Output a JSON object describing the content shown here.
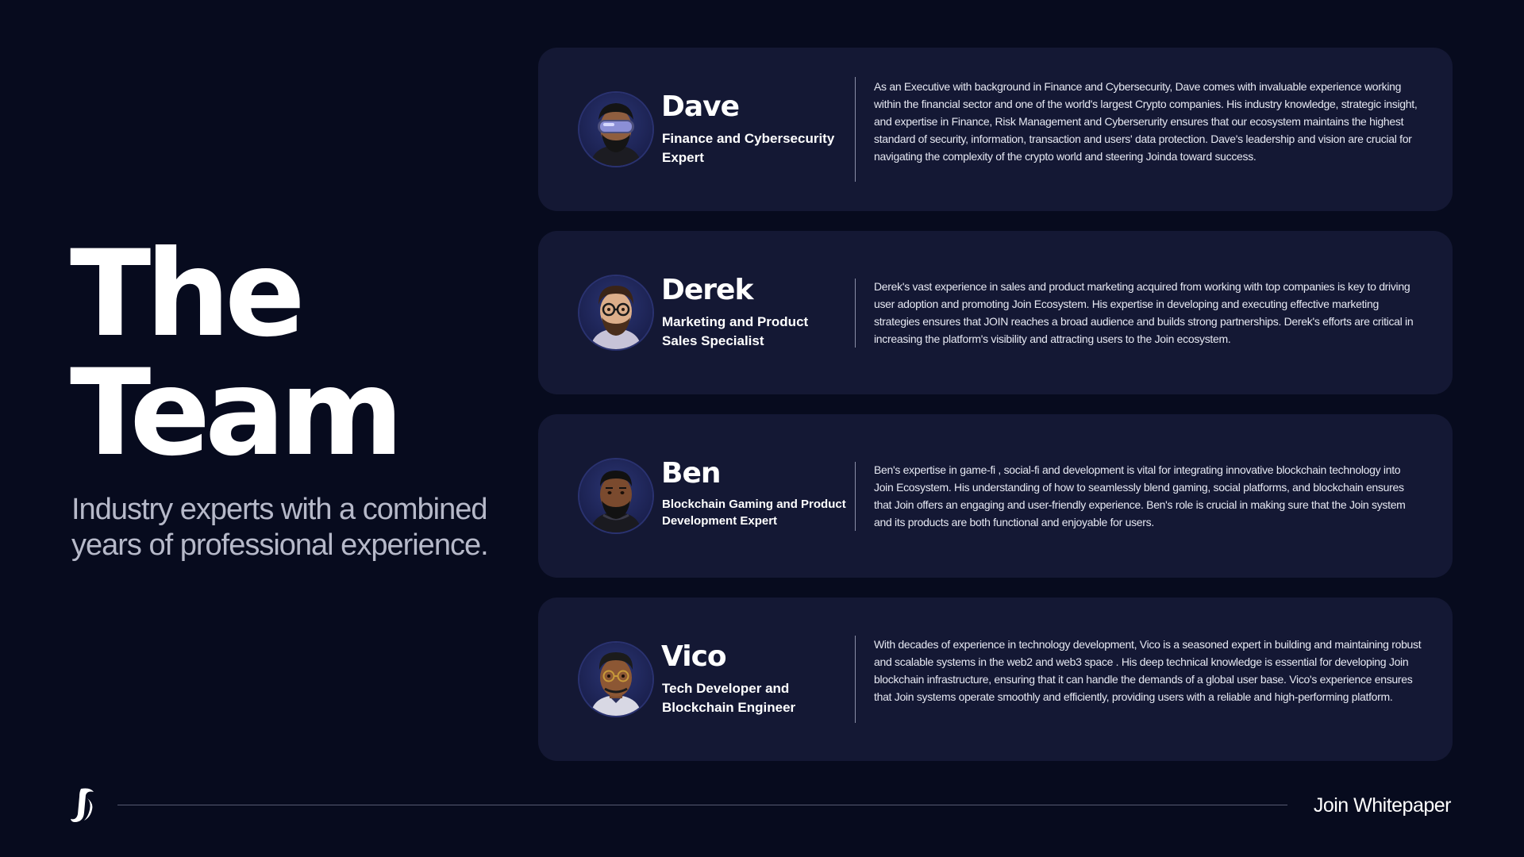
{
  "hero": {
    "title_line1": "The",
    "title_line2": "Team",
    "subtitle": "Industry experts with a combined years of professional experience."
  },
  "team": [
    {
      "name": "Dave",
      "role": "Finance and Cybersecurity Expert",
      "avatar_icon": "avatar-vr-headset-icon",
      "description": "As an Executive with background in Finance and Cybersecurity, Dave comes with invaluable experience working within the financial sector and one of the world's largest Crypto companies. His industry knowledge, strategic insight, and expertise in Finance, Risk Management and Cyberserurity ensures that our ecosystem maintains the highest standard of security, information, transaction and users' data protection. Dave's leadership and vision are crucial for navigating the complexity of the crypto world and steering Joinda toward success."
    },
    {
      "name": "Derek",
      "role": "Marketing and Product Sales Specialist",
      "avatar_icon": "avatar-glasses-icon",
      "description": "Derek's vast experience in sales and product marketing acquired from working with top companies is key to driving user adoption and promoting Join Ecosystem. His expertise in developing and executing effective marketing strategies ensures that JOIN reaches a broad audience and builds strong partnerships. Derek's efforts are critical in increasing the platform's visibility and attracting users to the Join ecosystem."
    },
    {
      "name": "Ben",
      "role": "Blockchain Gaming and Product Development Expert",
      "avatar_icon": "avatar-bearded-icon",
      "description": "Ben's expertise in game-fi , social-fi and development is vital for integrating innovative blockchain technology into Join Ecosystem. His understanding of how to seamlessly blend gaming, social platforms, and blockchain ensures that Join offers an engaging and user-friendly experience. Ben's role is crucial in making sure that the Join system and its products are both functional and enjoyable for users."
    },
    {
      "name": "Vico",
      "role": "Tech Developer and Blockchain Engineer",
      "avatar_icon": "avatar-round-glasses-icon",
      "description": "With decades of experience in technology development, Vico is a seasoned expert in building and maintaining robust and scalable systems in the web2 and web3 space . His deep technical knowledge is essential for developing Join blockchain infrastructure, ensuring that it can handle the demands of a global user base. Vico's experience ensures that Join systems operate smoothly and efficiently, providing users with a reliable and high-performing platform."
    }
  ],
  "footer": {
    "logo_icon": "join-logo-icon",
    "label": "Join Whitepaper"
  },
  "colors": {
    "background": "#070b1e",
    "card": "#141834",
    "subtitle": "#b6b9c9",
    "text": "#ffffff"
  }
}
